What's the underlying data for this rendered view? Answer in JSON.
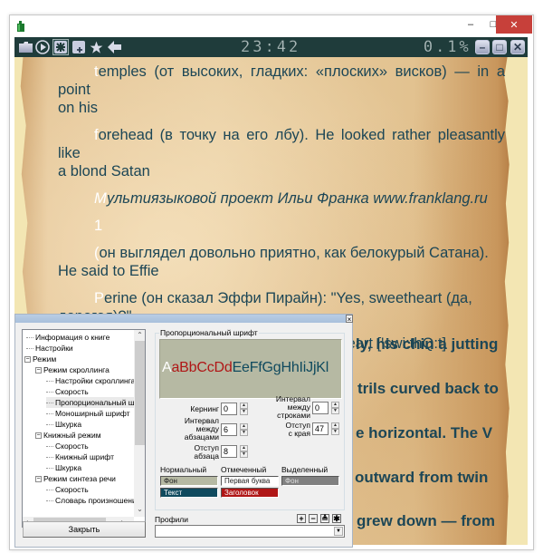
{
  "window": {
    "controls": {
      "minimize": "–",
      "maximize": "□",
      "close": "✕"
    }
  },
  "toolbar": {
    "icons": [
      "folder-icon",
      "play-icon",
      "settings-snowflake-icon",
      "add-bookmark-icon",
      "star-icon",
      "back-arrow-icon"
    ],
    "active_icon": "settings-snowflake-icon",
    "clock": "23:42",
    "progress": "0.1%",
    "right_buttons": [
      "minimize-icon",
      "restore-icon",
      "close-icon"
    ]
  },
  "reader": {
    "paragraphs": [
      {
        "first": "t",
        "rest": "emples (от высоких, гладких: «плоских» висков) — in a point",
        "cont": "on his",
        "italic": false
      },
      {
        "first": "f",
        "rest": "orehead (в точку на его лбу). He looked rather pleasantly like",
        "cont": "a blond Satan",
        "italic": false
      },
      {
        "first": "М",
        "rest": "ультиязыковой проект Ильи Франка www.franklang.ru",
        "cont": "",
        "italic": true
      },
      {
        "first": "1",
        "rest": "",
        "cont": "",
        "italic": false
      },
      {
        "first": "(",
        "rest": "он выглядел довольно приятно, как белокурый Сатана).",
        "cont": "He said to Effie",
        "italic": false
      },
      {
        "first": "P",
        "rest": "erine (он сказал Эффи Пирайн): \"Yes, sweetheart (да,",
        "cont": "дорогая)?\"",
        "italic": false
      },
      {
        "first": "j",
        "rest": "utting ['dZAtlŋ] nostril ['nOstrIl] sweetheart ['swi:thQ:t]",
        "cont": "",
        "italic": false
      }
    ],
    "bold_fragments": [
      "ly, his chin a jutting",
      "trils curved back to",
      "e horizontal. The V",
      "outward from twin",
      "grew down — from"
    ]
  },
  "dialog": {
    "close_glyph": "×",
    "tree": [
      {
        "label": "Информация о книге",
        "level": 0,
        "toggle": null
      },
      {
        "label": "Настройки",
        "level": 0,
        "toggle": null
      },
      {
        "label": "Режим",
        "level": 0,
        "toggle": "−"
      },
      {
        "label": "Режим скроллинга",
        "level": 1,
        "toggle": "−"
      },
      {
        "label": "Настройки скроллинга",
        "level": 2,
        "toggle": null
      },
      {
        "label": "Скорость",
        "level": 2,
        "toggle": null
      },
      {
        "label": "Пропорциональный шрифт",
        "level": 2,
        "toggle": null,
        "selected": true
      },
      {
        "label": "Моноширный шрифт",
        "level": 2,
        "toggle": null
      },
      {
        "label": "Шкурка",
        "level": 2,
        "toggle": null
      },
      {
        "label": "Книжный режим",
        "level": 1,
        "toggle": "−"
      },
      {
        "label": "Скорость",
        "level": 2,
        "toggle": null
      },
      {
        "label": "Книжный шрифт",
        "level": 2,
        "toggle": null
      },
      {
        "label": "Шкурка",
        "level": 2,
        "toggle": null
      },
      {
        "label": "Режим синтеза речи",
        "level": 1,
        "toggle": "−"
      },
      {
        "label": "Скорость",
        "level": 2,
        "toggle": null
      },
      {
        "label": "Словарь произношения",
        "level": 2,
        "toggle": null
      }
    ],
    "close_button": "Закрыть",
    "font_group": {
      "title": "Пропорциональный шрифт",
      "preview": {
        "first": "A",
        "red": "aBbCcDd",
        "blue": "EeFfGgHhIiJjKl"
      },
      "fields": {
        "kerning": {
          "label": "Кернинг",
          "value": "0"
        },
        "line_spacing": {
          "label": "Интервал между строками",
          "label_lines": [
            "Интервал",
            "между",
            "строками"
          ],
          "value": "0"
        },
        "para_spacing": {
          "label": "Интервал между абзацами",
          "label_lines": [
            "Интервал",
            "между",
            "абзацами"
          ],
          "value": "6"
        },
        "margin": {
          "label": "Отступ с края",
          "label_lines": [
            "Отступ",
            "с края"
          ],
          "value": "47"
        },
        "para_indent": {
          "label": "Отступ абзаца",
          "label_lines": [
            "Отступ",
            "абзаца"
          ],
          "value": "8"
        }
      },
      "color_columns": {
        "normal": {
          "label": "Нормальный",
          "bg": {
            "label": "Фон",
            "color": "#b6b9a3"
          },
          "text": {
            "label": "Текст",
            "color": "#0f4a5e"
          }
        },
        "marked": {
          "label": "Отмеченный",
          "first": {
            "label": "Первая буква",
            "color": "#ffffff"
          },
          "heading": {
            "label": "Заголовок",
            "color": "#b01616"
          }
        },
        "selected": {
          "label": "Выделенный",
          "bg": {
            "label": "Фон",
            "color": "#808080"
          }
        }
      }
    },
    "profiles": {
      "label": "Профили",
      "buttons": [
        "+",
        "−",
        "≜",
        "✱"
      ],
      "value": ""
    }
  },
  "colors": {
    "toolbar_bg": "#1f3c3b",
    "reader_text": "#1c4656",
    "close_red": "#c7403a"
  }
}
